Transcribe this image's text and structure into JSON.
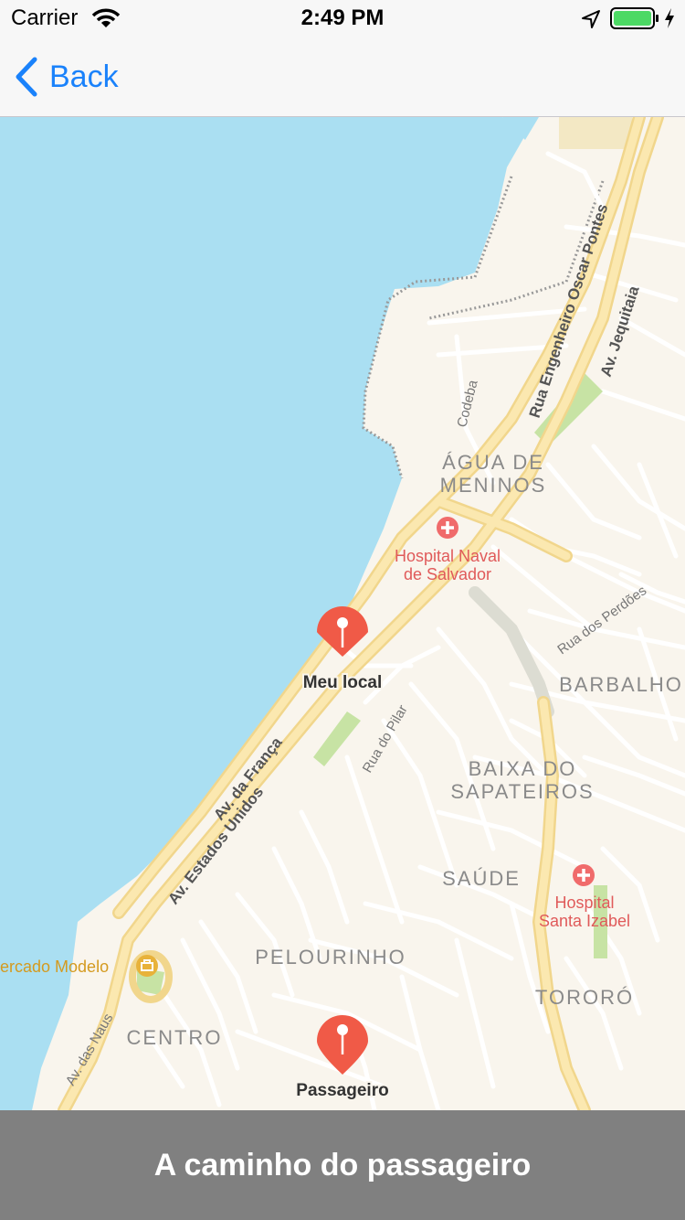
{
  "status_bar": {
    "carrier": "Carrier",
    "time": "2:49 PM"
  },
  "nav": {
    "back_label": "Back"
  },
  "map": {
    "colors": {
      "water": "#aadff2",
      "land": "#f9f5ed",
      "major_road": "#fbe39a",
      "minor_road": "#ffffff",
      "park": "#c7e3a4",
      "pin": "#f05a47",
      "poi_label": "#e05a5a",
      "district_label": "#8a8a8a"
    },
    "districts": {
      "agua_de_meninos_1": "ÁGUA DE",
      "agua_de_meninos_2": "MENINOS",
      "barbalho": "BARBALHO",
      "baixa_1": "BAIXA DO",
      "baixa_2": "SAPATEIROS",
      "saude": "SAÚDE",
      "pelourinho": "PELOURINHO",
      "centro": "CENTRO",
      "tororo": "TORORÓ"
    },
    "pois": {
      "hospital_naval_1": "Hospital Naval",
      "hospital_naval_2": "de Salvador",
      "hospital_santa_1": "Hospital",
      "hospital_santa_2": "Santa Izabel",
      "mercado": "ercado Modelo"
    },
    "streets": {
      "oscar_pontes": "Rua Engenheiro Oscar Pontes",
      "jequitaia": "Av. Jequitaia",
      "codeba": "Codeba",
      "perdoes": "Rua dos Perdões",
      "pilar": "Rua do Pilar",
      "franca": "Av. da França",
      "estados_unidos": "Av. Estados Unidos",
      "naus": "Av. das Naus"
    },
    "pins": {
      "meu_local": "Meu local",
      "passageiro": "Passageiro"
    }
  },
  "bottom_bar": {
    "label": "A caminho do passageiro"
  }
}
